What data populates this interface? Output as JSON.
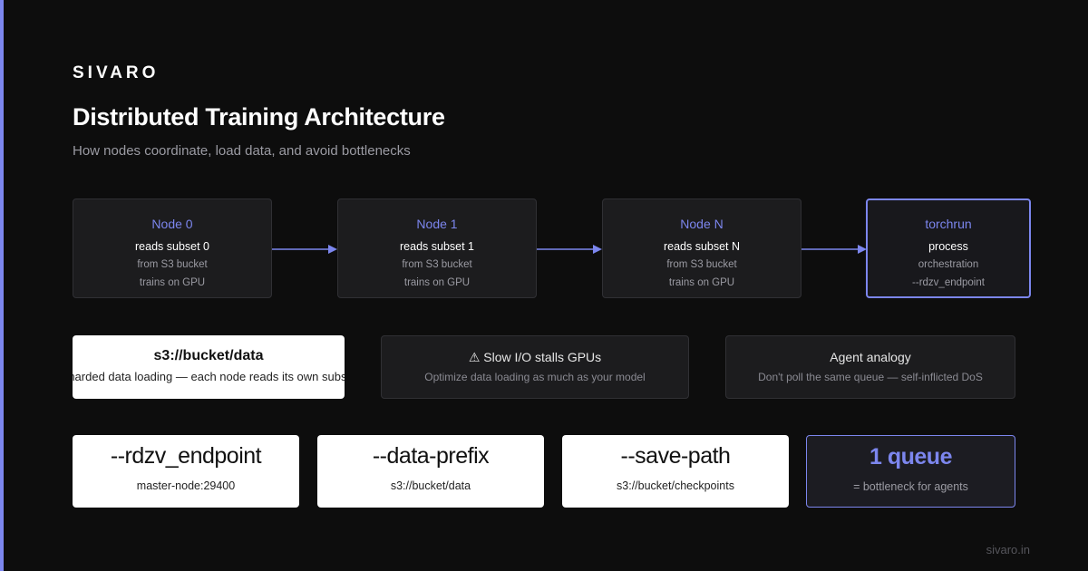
{
  "brand": "SIVARO",
  "title": "Distributed Training Architecture",
  "subtitle": "How nodes coordinate, load data, and avoid bottlenecks",
  "colors": {
    "accent": "#7c86ee",
    "background": "#0d0d0d",
    "card": "#1c1c1e"
  },
  "nodes": [
    {
      "title": "Node 0",
      "line1": "reads subset 0",
      "line2": "from S3 bucket",
      "line3": "trains on GPU"
    },
    {
      "title": "Node 1",
      "line1": "reads subset 1",
      "line2": "from S3 bucket",
      "line3": "trains on GPU"
    },
    {
      "title": "Node N",
      "line1": "reads subset N",
      "line2": "from S3 bucket",
      "line3": "trains on GPU"
    },
    {
      "title": "torchrun",
      "line1": "process",
      "line2": "orchestration",
      "line3": "--rdzv_endpoint"
    }
  ],
  "info_cards": [
    {
      "title": "s3://bucket/data",
      "desc": "Sharded data loading — each node reads its own subset"
    },
    {
      "title": "⚠ Slow I/O stalls GPUs",
      "desc": "Optimize data loading as much as your model"
    },
    {
      "title": "Agent analogy",
      "desc": "Don't poll the same queue — self-inflicted DoS"
    }
  ],
  "stats": [
    {
      "value": "--rdzv_endpoint",
      "label": "master-node:29400"
    },
    {
      "value": "--data-prefix",
      "label": "s3://bucket/data"
    },
    {
      "value": "--save-path",
      "label": "s3://bucket/checkpoints"
    },
    {
      "value": "1 queue",
      "label": "= bottleneck for agents"
    }
  ],
  "footer": "sivaro.in"
}
